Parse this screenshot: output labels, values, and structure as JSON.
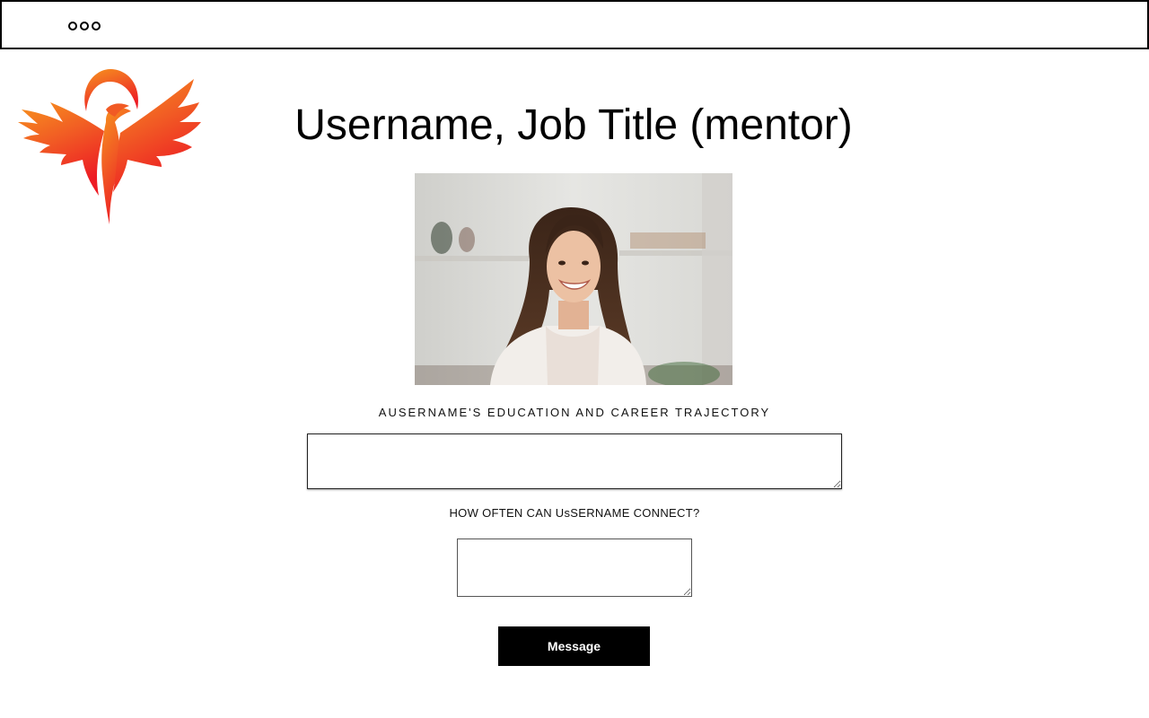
{
  "header": {
    "menu_icon": "more-dots-icon"
  },
  "logo": {
    "icon": "phoenix-logo",
    "colors": [
      "#f7931e",
      "#f15a24",
      "#ed1c24"
    ]
  },
  "profile": {
    "title": "Username, Job Title (mentor)",
    "photo_icon": "profile-photo"
  },
  "trajectory": {
    "label": "AUSERNAME'S EDUCATION AND CAREER TRAJECTORY",
    "value": ""
  },
  "connect": {
    "label": "HOW OFTEN CAN UsSERNAME CONNECT?",
    "value": ""
  },
  "actions": {
    "message_label": "Message",
    "button_color": "#000000"
  }
}
